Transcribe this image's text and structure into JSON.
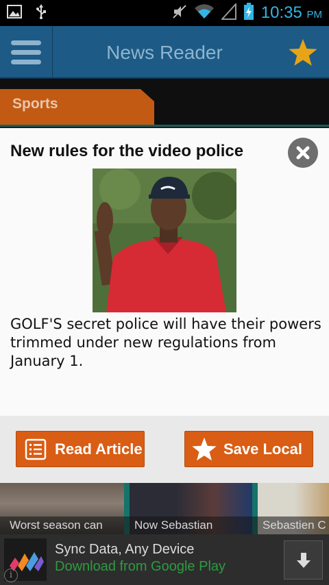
{
  "status_bar": {
    "time": "10:35",
    "ampm": "PM",
    "icons": [
      "image-icon",
      "usb-icon",
      "mute-icon",
      "wifi-icon",
      "signal-icon",
      "battery-charging-icon"
    ]
  },
  "app_bar": {
    "title": "News Reader",
    "menu_icon": "hamburger-menu-icon",
    "favorite_icon": "star-icon"
  },
  "category": {
    "label": "Sports"
  },
  "article": {
    "title": "New rules for the video police",
    "summary": "GOLF'S secret police will have their powers trimmed under new regulations from January 1.",
    "close_icon": "close-icon"
  },
  "actions": {
    "read_label": "Read Article",
    "save_label": "Save Local",
    "read_icon": "list-document-icon",
    "save_icon": "star-icon"
  },
  "related": [
    {
      "caption": "Worst season can"
    },
    {
      "caption": "Now Sebastian"
    },
    {
      "caption": "Sebastien C"
    }
  ],
  "ad": {
    "title": "Sync Data, Any Device",
    "subtitle": "Download from Google Play",
    "download_icon": "download-arrow-icon",
    "info_icon": "info-icon"
  },
  "colors": {
    "app_bar": "#1d5a85",
    "accent_orange": "#d95d14",
    "category_tab": "#c25a14",
    "status_time": "#33b5e5",
    "ad_subtitle": "#2c9c3f"
  }
}
